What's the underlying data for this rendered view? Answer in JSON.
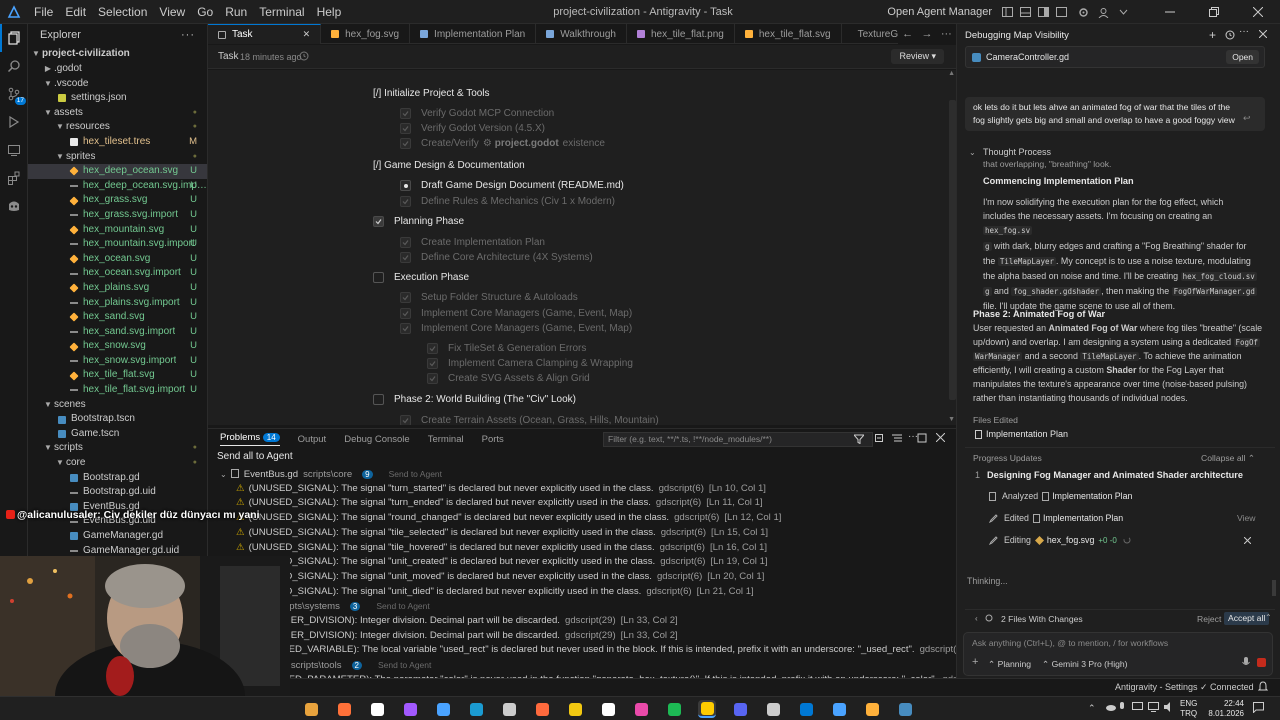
{
  "titlebar": {
    "menu": [
      "File",
      "Edit",
      "Selection",
      "View",
      "Go",
      "Run",
      "Terminal",
      "Help"
    ],
    "window_title": "project-civilization - Antigravity - Task",
    "open_agent_manager": "Open Agent Manager"
  },
  "sidebar": {
    "title": "Explorer",
    "root": "project-civilization",
    "items": [
      {
        "label": ".godot",
        "depth": 1,
        "type": "folder",
        "open": false,
        "badge": ""
      },
      {
        "label": ".vscode",
        "depth": 1,
        "type": "folder",
        "open": true,
        "badge": ""
      },
      {
        "label": "settings.json",
        "depth": 2,
        "type": "json",
        "badge": ""
      },
      {
        "label": "assets",
        "depth": 1,
        "type": "folder",
        "open": true,
        "badge": "dot"
      },
      {
        "label": "resources",
        "depth": 2,
        "type": "folder",
        "open": true,
        "badge": "dot"
      },
      {
        "label": "hex_tileset.tres",
        "depth": 3,
        "type": "res",
        "badge": "M"
      },
      {
        "label": "sprites",
        "depth": 2,
        "type": "folder",
        "open": true,
        "badge": "dot"
      },
      {
        "label": "hex_deep_ocean.svg",
        "depth": 3,
        "type": "svg",
        "badge": "U",
        "selected": true
      },
      {
        "label": "hex_deep_ocean.svg.import",
        "depth": 3,
        "type": "import",
        "badge": "U"
      },
      {
        "label": "hex_grass.svg",
        "depth": 3,
        "type": "svg",
        "badge": "U"
      },
      {
        "label": "hex_grass.svg.import",
        "depth": 3,
        "type": "import",
        "badge": "U"
      },
      {
        "label": "hex_mountain.svg",
        "depth": 3,
        "type": "svg",
        "badge": "U"
      },
      {
        "label": "hex_mountain.svg.import",
        "depth": 3,
        "type": "import",
        "badge": "U"
      },
      {
        "label": "hex_ocean.svg",
        "depth": 3,
        "type": "svg",
        "badge": "U"
      },
      {
        "label": "hex_ocean.svg.import",
        "depth": 3,
        "type": "import",
        "badge": "U"
      },
      {
        "label": "hex_plains.svg",
        "depth": 3,
        "type": "svg",
        "badge": "U"
      },
      {
        "label": "hex_plains.svg.import",
        "depth": 3,
        "type": "import",
        "badge": "U"
      },
      {
        "label": "hex_sand.svg",
        "depth": 3,
        "type": "svg",
        "badge": "U"
      },
      {
        "label": "hex_sand.svg.import",
        "depth": 3,
        "type": "import",
        "badge": "U"
      },
      {
        "label": "hex_snow.svg",
        "depth": 3,
        "type": "svg",
        "badge": "U"
      },
      {
        "label": "hex_snow.svg.import",
        "depth": 3,
        "type": "import",
        "badge": "U"
      },
      {
        "label": "hex_tile_flat.svg",
        "depth": 3,
        "type": "svg",
        "badge": "U"
      },
      {
        "label": "hex_tile_flat.svg.import",
        "depth": 3,
        "type": "import",
        "badge": "U"
      },
      {
        "label": "scenes",
        "depth": 1,
        "type": "folder",
        "open": true,
        "badge": ""
      },
      {
        "label": "Bootstrap.tscn",
        "depth": 2,
        "type": "scene",
        "badge": ""
      },
      {
        "label": "Game.tscn",
        "depth": 2,
        "type": "scene",
        "badge": ""
      },
      {
        "label": "scripts",
        "depth": 1,
        "type": "folder",
        "open": true,
        "badge": "dot"
      },
      {
        "label": "core",
        "depth": 2,
        "type": "folder",
        "open": true,
        "badge": "dot"
      },
      {
        "label": "Bootstrap.gd",
        "depth": 3,
        "type": "gd",
        "badge": ""
      },
      {
        "label": "Bootstrap.gd.uid",
        "depth": 3,
        "type": "uid",
        "badge": ""
      },
      {
        "label": "EventBus.gd",
        "depth": 3,
        "type": "gd",
        "badge": ""
      },
      {
        "label": "EventBus.gd.uid",
        "depth": 3,
        "type": "uid",
        "badge": ""
      },
      {
        "label": "GameManager.gd",
        "depth": 3,
        "type": "gd",
        "badge": ""
      },
      {
        "label": "GameManager.gd.uid",
        "depth": 3,
        "type": "uid",
        "badge": ""
      }
    ]
  },
  "tabs": [
    {
      "label": "Task",
      "active": true,
      "icon": "task"
    },
    {
      "label": "hex_fog.svg",
      "icon": "svg"
    },
    {
      "label": "Implementation Plan",
      "icon": "doc"
    },
    {
      "label": "Walkthrough",
      "icon": "doc"
    },
    {
      "label": "hex_tile_flat.png",
      "icon": "img"
    },
    {
      "label": "hex_tile_flat.svg",
      "icon": "svg"
    },
    {
      "label": "TextureGenerator.g",
      "icon": "gd"
    }
  ],
  "task_header": {
    "label": "Task",
    "time": "18 minutes ago",
    "review": "Review"
  },
  "task_items": [
    {
      "text": "[/] Initialize Project & Tools",
      "kind": "heading",
      "level": 0
    },
    {
      "text": "Verify Godot MCP Connection",
      "kind": "item",
      "level": 1,
      "state": "done"
    },
    {
      "text": "Verify Godot Version (4.5.X)",
      "kind": "item",
      "level": 1,
      "state": "done"
    },
    {
      "text": "Create/Verify",
      "bold": "project.godot",
      "after": "existence",
      "kind": "item",
      "level": 1,
      "state": "done"
    },
    {
      "text": "[/] Game Design & Documentation",
      "kind": "heading",
      "level": 0
    },
    {
      "text": "Draft Game Design Document (README.md)",
      "kind": "item",
      "level": 1,
      "state": "progress"
    },
    {
      "text": "Define Rules & Mechanics (Civ 1 x Modern)",
      "kind": "item",
      "level": 1,
      "state": "done"
    },
    {
      "text": "Planning Phase",
      "kind": "section",
      "level": 0,
      "state": "checked"
    },
    {
      "text": "Create Implementation Plan",
      "kind": "item",
      "level": 1,
      "state": "done"
    },
    {
      "text": "Define Core Architecture (4X Systems)",
      "kind": "item",
      "level": 1,
      "state": "done"
    },
    {
      "text": "Execution Phase",
      "kind": "section",
      "level": 0,
      "state": "open"
    },
    {
      "text": "Setup Folder Structure & Autoloads",
      "kind": "item",
      "level": 1,
      "state": "done"
    },
    {
      "text": "Implement Core Managers (Game, Event, Map)",
      "kind": "item",
      "level": 1,
      "state": "done"
    },
    {
      "text": "Implement Core Managers (Game, Event, Map)",
      "kind": "item",
      "level": 1,
      "state": "done"
    },
    {
      "text": "Fix TileSet & Generation Errors",
      "kind": "item",
      "level": 2,
      "state": "done"
    },
    {
      "text": "Implement Camera Clamping & Wrapping",
      "kind": "item",
      "level": 2,
      "state": "done"
    },
    {
      "text": "Create SVG Assets & Align Grid",
      "kind": "item",
      "level": 2,
      "state": "done"
    },
    {
      "text": "Phase 2: World Building (The \"Civ\" Look)",
      "kind": "section",
      "level": 0,
      "state": "open"
    },
    {
      "text": "Create Terrain Assets (Ocean, Grass, Hills, Mountain)",
      "kind": "item",
      "level": 1,
      "state": "done"
    }
  ],
  "panel": {
    "tabs": [
      "Problems",
      "Output",
      "Debug Console",
      "Terminal",
      "Ports"
    ],
    "problems_count": "14",
    "filter_placeholder": "Filter (e.g. text, **/*.ts, !**/node_modules/**)",
    "send_all": "Send all to Agent",
    "rows": [
      {
        "kind": "file",
        "text": "EventBus.gd",
        "path": "scripts\\core",
        "count": "9",
        "action": "Send to Agent"
      },
      {
        "kind": "warn",
        "text": "(UNUSED_SIGNAL): The signal \"turn_started\" is declared but never explicitly used in the class.",
        "src": "gdscript(6)",
        "loc": "[Ln 10, Col 1]"
      },
      {
        "kind": "warn",
        "text": "(UNUSED_SIGNAL): The signal \"turn_ended\" is declared but never explicitly used in the class.",
        "src": "gdscript(6)",
        "loc": "[Ln 11, Col 1]"
      },
      {
        "kind": "warn",
        "text": "(UNUSED_SIGNAL): The signal \"round_changed\" is declared but never explicitly used in the class.",
        "src": "gdscript(6)",
        "loc": "[Ln 12, Col 1]"
      },
      {
        "kind": "warn",
        "text": "(UNUSED_SIGNAL): The signal \"tile_selected\" is declared but never explicitly used in the class.",
        "src": "gdscript(6)",
        "loc": "[Ln 15, Col 1]"
      },
      {
        "kind": "warn",
        "text": "(UNUSED_SIGNAL): The signal \"tile_hovered\" is declared but never explicitly used in the class.",
        "src": "gdscript(6)",
        "loc": "[Ln 16, Col 1]"
      },
      {
        "kind": "warn",
        "text": "(UNUSED_SIGNAL): The signal \"unit_created\" is declared but never explicitly used in the class.",
        "src": "gdscript(6)",
        "loc": "[Ln 19, Col 1]"
      },
      {
        "kind": "warn",
        "text": "(UNUSED_SIGNAL): The signal \"unit_moved\" is declared but never explicitly used in the class.",
        "src": "gdscript(6)",
        "loc": "[Ln 20, Col 1]"
      },
      {
        "kind": "warn",
        "text": "(UNUSED_SIGNAL): The signal \"unit_died\" is declared but never explicitly used in the class.",
        "src": "gdscript(6)",
        "loc": "[Ln 21, Col 1]"
      },
      {
        "kind": "file",
        "text": "…r.gd",
        "path": "scripts\\systems",
        "count": "3",
        "action": "Send to Agent"
      },
      {
        "kind": "warn",
        "text": "…(INTEGER_DIVISION): Integer division. Decimal part will be discarded.",
        "src": "gdscript(29)",
        "loc": "[Ln 33, Col 2]"
      },
      {
        "kind": "warn",
        "text": "…(INTEGER_DIVISION): Integer division. Decimal part will be discarded.",
        "src": "gdscript(29)",
        "loc": "[Ln 33, Col 2]"
      },
      {
        "kind": "warn",
        "text": "…(UNUSED_VARIABLE): The local variable \"used_rect\" is declared but never used in the block. If this is intended, prefix it with an underscore: \"_used_rect\".",
        "src": "gdscript(2)",
        "loc": "[Ln 37, Col 2]"
      },
      {
        "kind": "file",
        "text": "…rator.gd",
        "path": "scripts\\tools",
        "count": "2",
        "action": "Send to Agent"
      },
      {
        "kind": "warn",
        "text": "…(UNUSED_PARAMETER): The parameter \"color\" is never used in the function \"generate_hex_texture()\". If this is intended, prefix it with an underscore: \"_color\".",
        "src": "gdscript(5)",
        "loc": "[Ln 4, Col 1]"
      }
    ]
  },
  "agent": {
    "title": "Debugging Map Visibility",
    "file_chip": "CameraController.gd",
    "open_btn": "Open",
    "user_message": "ok lets do it but lets ahve an animated fog of  war that the tiles of the fog slightly gets big and small and overlap to have a good foggy view",
    "thought_label": "Thought Process",
    "thought_tail": "that overlapping, \"breathing\" look.",
    "thought_heading": "Commencing Implementation Plan",
    "thought_p": [
      "I'm now solidifying the execution plan for the fog effect, which",
      "includes the necessary assets. I'm focusing on creating an",
      "with dark, blurry edges and crafting a \"Fog Breathing\" shader for",
      "the",
      ". My concept is to use a noise texture, modulating",
      "the alpha based on noise and time. I'll be creating",
      "and",
      ", then making the",
      "file. I'll update the game scene to use all of them."
    ],
    "code_terms": [
      "hex_fog.sv",
      "g",
      "TileMapLayer",
      "hex_fog_cloud.sv",
      "g",
      "fog_shader.gdshader",
      "FogOfWarManager.gd"
    ],
    "phase_title": "Phase 2: Animated Fog of War",
    "phase_body": [
      "User requested an",
      "Animated Fog of War",
      "where fog tiles \"breathe\" (scale",
      "up/down) and overlap. I am designing a system using a dedicated",
      "FogOf",
      "WarManager",
      "and a second",
      "TileMapLayer",
      ". To achieve the animation",
      "efficiently, I will creating a custom",
      "Shader",
      "for the Fog Layer that",
      "manipulates the texture's appearance over time (noise-based pulsing)",
      "rather than instantiating thousands of individual nodes."
    ],
    "files_edited_label": "Files Edited",
    "files_edited_item": "Implementation Plan",
    "progress_label": "Progress Updates",
    "collapse_all": "Collapse all",
    "progress_num": "1",
    "progress_title": "Designing Fog Manager and Animated Shader architecture",
    "steps": [
      {
        "verb": "Analyzed",
        "target": "Implementation Plan",
        "extra": ""
      },
      {
        "verb": "Edited",
        "target": "Implementation Plan",
        "extra": "View"
      },
      {
        "verb": "Editing",
        "target": "hex_fog.svg",
        "extra": "+0 -0"
      }
    ],
    "thinking": "Thinking...",
    "files_changed": "2 Files With Changes",
    "reject_all": "Reject all",
    "accept_all": "Accept all",
    "input_placeholder": "Ask anything (Ctrl+L), @ to mention, / for workflows",
    "mode": "Planning",
    "model": "Gemini 3 Pro (High)"
  },
  "statusbar": {
    "settings": "Antigravity - Settings",
    "connected": "Connected"
  },
  "overlay_text": "@alicanulusaler: Civ dekiler düz dünyacı mı yani",
  "tray": {
    "lang1": "ENG",
    "lang2": "TRQ",
    "time": "22:44",
    "date": "8.01.2026"
  },
  "colors": {
    "accent": "#0078d4",
    "warning": "#cca700",
    "untracked": "#73c991",
    "modified": "#e2c08d"
  }
}
